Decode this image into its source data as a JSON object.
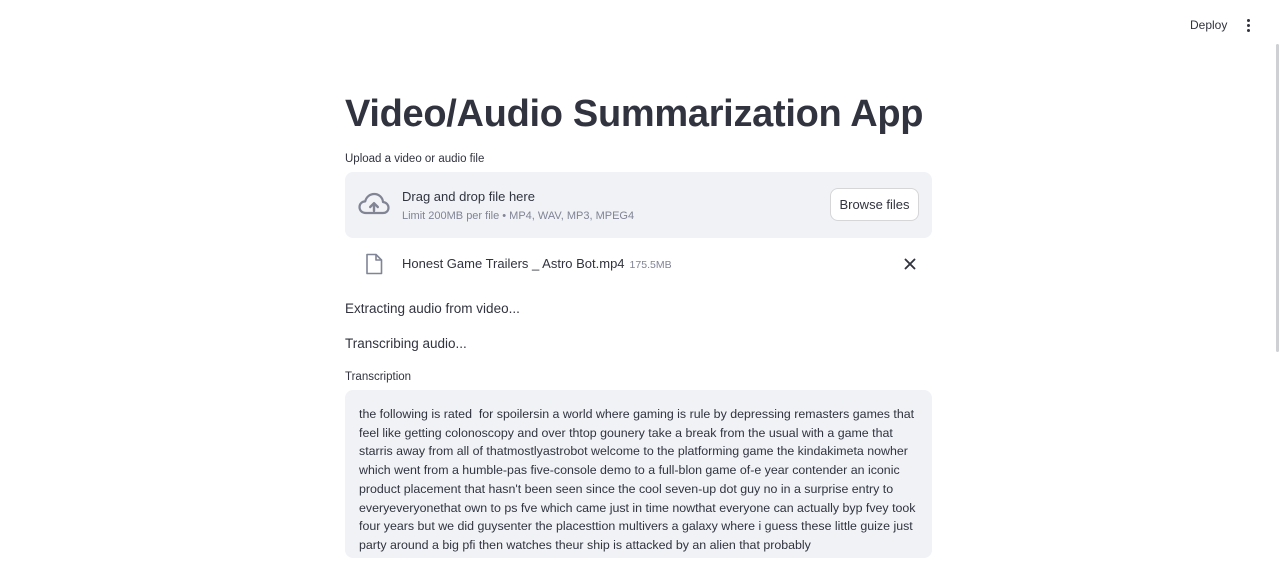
{
  "header": {
    "deploy_label": "Deploy",
    "menu_icon": "more-vertical-icon"
  },
  "main": {
    "title": "Video/Audio Summarization App",
    "uploader": {
      "label": "Upload a video or audio file",
      "drop_title": "Drag and drop file here",
      "drop_subtitle": "Limit 200MB per file • MP4, WAV, MP3, MPEG4",
      "browse_label": "Browse files",
      "upload_icon": "cloud-upload-icon"
    },
    "uploaded_file": {
      "name": "Honest Game Trailers _ Astro Bot.mp4",
      "size": "175.5MB",
      "file_icon": "file-icon",
      "remove_icon": "close-icon"
    },
    "status": [
      "Extracting audio from video...",
      "Transcribing audio..."
    ],
    "transcription": {
      "label": "Transcription",
      "text": "the following is rated  for spoilersin a world where gaming is rule by depressing remasters games that feel like getting colonoscopy and over thtop gounery take a break from the usual with a game that starris away from all of thatmostlyastrobot welcome to the platforming game the kindakimeta nowher which went from a humble-pas five-console demo to a full-blon game of-e year contender an iconic product placement that hasn't been seen since the cool seven-up dot guy no in a surprise entry to everyeveryonethat own to ps fve which came just in time nowthat everyone can actually byp fvey took four years but we did guysenter the placesttion multivers a galaxy where i guess these little guize just party around a big pfi then watches theur ship is attacked by an alien that probably"
    }
  },
  "colors": {
    "text": "#31333f",
    "muted": "#808495",
    "panel_bg": "#f0f2f6",
    "border": "#d6d6d9"
  }
}
